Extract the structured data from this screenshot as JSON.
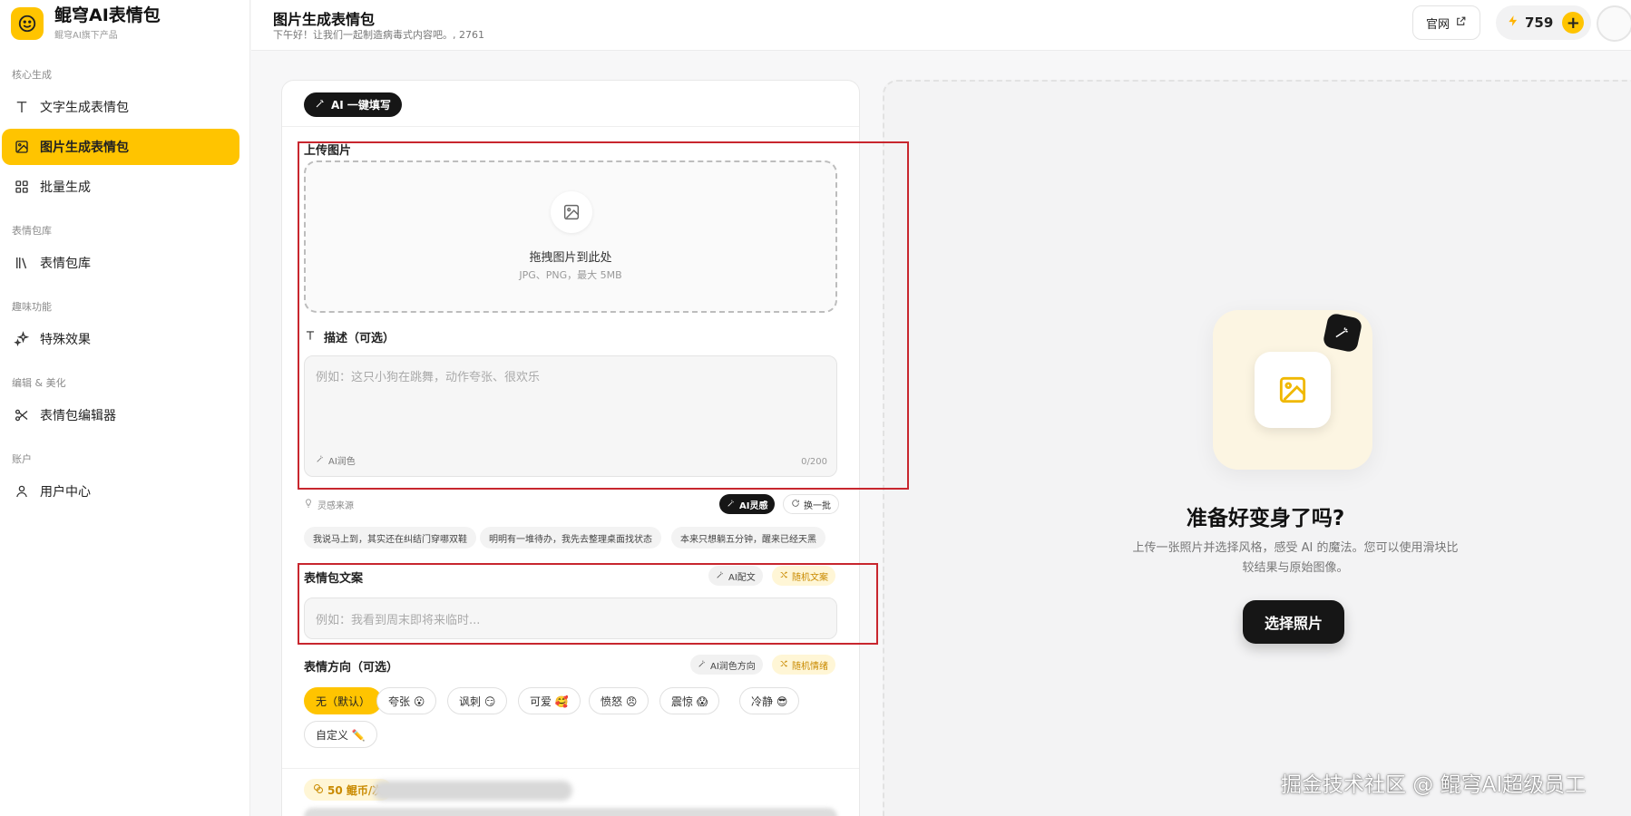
{
  "brand": {
    "name": "鲲穹AI表情包",
    "sub": "鲲穹AI旗下产品"
  },
  "sidebar": {
    "sections": [
      {
        "label": "核心生成",
        "items": [
          "文字生成表情包",
          "图片生成表情包",
          "批量生成"
        ]
      },
      {
        "label": "表情包库",
        "items": [
          "表情包库"
        ]
      },
      {
        "label": "趣味功能",
        "items": [
          "特殊效果"
        ]
      },
      {
        "label": "编辑 & 美化",
        "items": [
          "表情包编辑器"
        ]
      },
      {
        "label": "账户",
        "items": [
          "用户中心"
        ]
      }
    ]
  },
  "header": {
    "title": "图片生成表情包",
    "subtitle": "下午好！让我们一起制造病毒式内容吧。, 2761",
    "official": "官网",
    "credits": "759",
    "plus": "+"
  },
  "form": {
    "ai_write": "AI 一键填写",
    "upload_label": "上传图片",
    "drop_text": "拖拽图片到此处",
    "drop_hint": "JPG、PNG，最大 5MB",
    "desc_label": "描述（可选）",
    "desc_placeholder": "例如：这只小狗在跳舞，动作夸张、很欢乐",
    "ai_polish": "AI润色",
    "counter": "0/200",
    "inspire_label": "灵感来源",
    "ai_inspire": "AI灵感",
    "refresh": "换一批",
    "suggestions": [
      "我说马上到，其实还在纠结门穿哪双鞋",
      "明明有一堆待办，我先去整理桌面找状态",
      "本来只想躺五分钟，醒来已经天黑"
    ],
    "caption_label": "表情包文案",
    "ai_caption": "AI配文",
    "random_caption": "随机文案",
    "caption_placeholder": "例如：我看到周末即将来临时...",
    "mood_label": "表情方向（可选）",
    "ai_mood": "AI润色方向",
    "random_mood": "随机情绪",
    "moods": [
      "无（默认）",
      "夸张 😮",
      "讽刺 😏",
      "可爱 🥰",
      "愤怒 😠",
      "震惊 😱",
      "冷静 😎",
      "自定义 ✏️"
    ],
    "cost": "50 鲲币/次"
  },
  "preview": {
    "title": "准备好变身了吗?",
    "desc": "上传一张照片并选择风格，感受 AI 的魔法。您可以使用滑块比较结果与原始图像。",
    "button": "选择照片"
  },
  "watermark": "掘金技术社区 @ 鲲穹AI超级员工",
  "colors": {
    "accent": "#ffc400",
    "dark": "#161616",
    "highlight": "#c8262e"
  }
}
